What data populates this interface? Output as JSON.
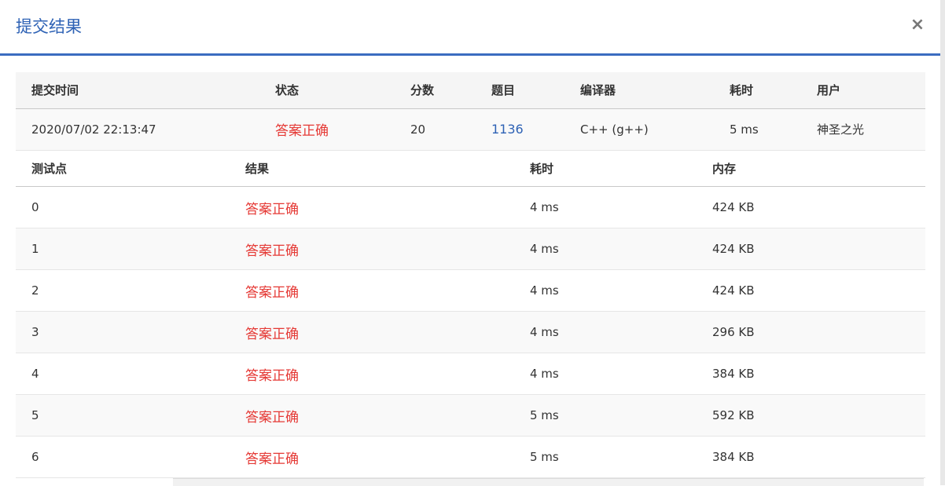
{
  "modal": {
    "title": "提交结果",
    "close_label": "×"
  },
  "submission": {
    "headers": [
      "提交时间",
      "状态",
      "分数",
      "题目",
      "编译器",
      "耗时",
      "用户"
    ],
    "row": {
      "time": "2020/07/02 22:13:47",
      "status": "答案正确",
      "score": "20",
      "problem": "1136",
      "compiler": "C++ (g++)",
      "duration": "5 ms",
      "user": "神圣之光"
    }
  },
  "cases": {
    "headers": [
      "测试点",
      "结果",
      "耗时",
      "内存"
    ],
    "rows": [
      {
        "id": "0",
        "result": "答案正确",
        "time": "4 ms",
        "memory": "424 KB"
      },
      {
        "id": "1",
        "result": "答案正确",
        "time": "4 ms",
        "memory": "424 KB"
      },
      {
        "id": "2",
        "result": "答案正确",
        "time": "4 ms",
        "memory": "424 KB"
      },
      {
        "id": "3",
        "result": "答案正确",
        "time": "4 ms",
        "memory": "296 KB"
      },
      {
        "id": "4",
        "result": "答案正确",
        "time": "4 ms",
        "memory": "384 KB"
      },
      {
        "id": "5",
        "result": "答案正确",
        "time": "5 ms",
        "memory": "592 KB"
      },
      {
        "id": "6",
        "result": "答案正确",
        "time": "5 ms",
        "memory": "384 KB"
      }
    ]
  },
  "colors": {
    "title": "#2e62b5",
    "accent_border": "#3b6cc0",
    "accepted": "#e53935",
    "link": "#2e62b5"
  }
}
